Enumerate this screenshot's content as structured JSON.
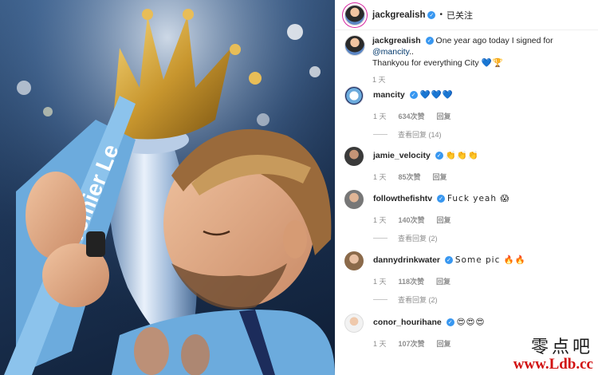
{
  "post": {
    "username": "jackgrealish",
    "follow_state": "已关注",
    "dot": "•",
    "caption_line1_prefix": "One year ago today I signed for",
    "caption_mention": "@mancity",
    "caption_line1_suffix": "..",
    "caption_line2": "Thankyou for everything City",
    "caption_emoji": "💙🏆",
    "caption_time": "1 天"
  },
  "comments": [
    {
      "username": "mancity",
      "text": "💙💙💙",
      "time": "1 天",
      "likes": "634次赞",
      "reply": "回复",
      "view_replies": "查看回复 (14)",
      "avatar_icon": "city-crest-icon"
    },
    {
      "username": "jamie_velocity",
      "text": "👏👏👏",
      "time": "1 天",
      "likes": "85次赞",
      "reply": "回复",
      "view_replies": "",
      "avatar_icon": ""
    },
    {
      "username": "followthefishtv",
      "text": "Fuck yeah 😱",
      "time": "1 天",
      "likes": "140次赞",
      "reply": "回复",
      "view_replies": "查看回复 (2)",
      "avatar_icon": ""
    },
    {
      "username": "dannydrinkwater",
      "text": "Some pic 🔥🔥",
      "time": "1 天",
      "likes": "118次赞",
      "reply": "回复",
      "view_replies": "查看回复 (2)",
      "avatar_icon": ""
    },
    {
      "username": "conor_hourihane",
      "text": "😍😍😍",
      "time": "1 天",
      "likes": "107次赞",
      "reply": "回复",
      "view_replies": "",
      "avatar_icon": ""
    }
  ],
  "watermark": {
    "top": "零点吧",
    "url": "www.Ldb.cc"
  },
  "photo_text": {
    "ribbon": "Premier Le"
  },
  "colors": {
    "verified": "#3897f0",
    "city_blue": "#6cabdd",
    "muted": "#8e8e8e",
    "watermark_red": "#d11010"
  }
}
